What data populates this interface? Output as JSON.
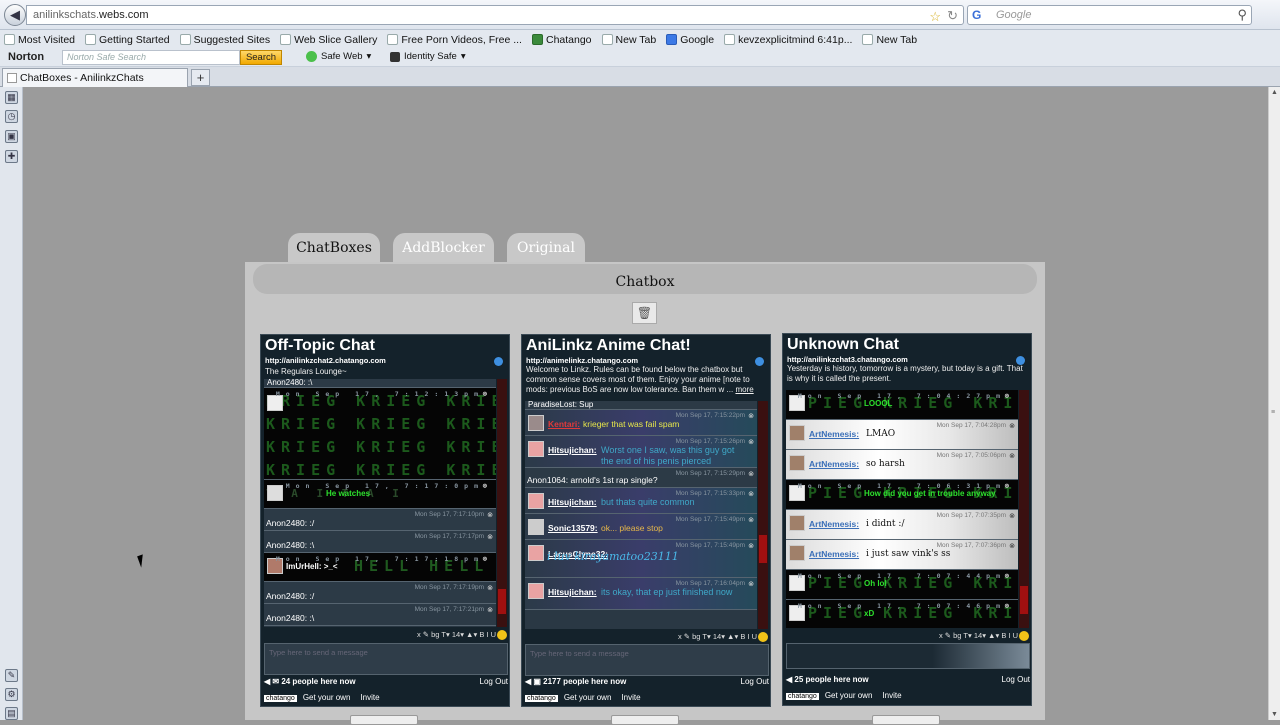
{
  "browser": {
    "url_prefix": "anilinkschats.",
    "url_domain": "webs.com",
    "search_placeholder": "Google",
    "search_engine_icon": "G"
  },
  "bookmarks": [
    "Most Visited",
    "Getting Started",
    "Suggested Sites",
    "Web Slice Gallery",
    "Free Porn Videos, Free ...",
    "Chatango",
    "New Tab",
    "Google",
    "kevzexplicitmind 6:41p...",
    "New Tab"
  ],
  "norton": {
    "logo": "Norton",
    "search_placeholder": "Norton Safe Search",
    "search_button": "Search",
    "safe_web": "Safe Web",
    "identity_safe": "Identity Safe"
  },
  "tab": {
    "title": "ChatBoxes - AnilinkzChats",
    "new_tab": "+"
  },
  "site": {
    "tabs": [
      "ChatBoxes",
      "AddBlocker",
      "Original"
    ],
    "header": "Chatbox"
  },
  "chats": [
    {
      "title": "Off-Topic Chat",
      "url": "http://anilinkzchat2.chatango.com",
      "desc": "The Regulars Lounge~",
      "people": "24 people here now",
      "logout": "Log Out",
      "top_clip": "Anon2480: :\\",
      "messages": [
        {
          "kind": "krieg",
          "big": true,
          "ts": "Mon Sep 17, 7:12:13pm",
          "text": "KRIEG KRIEG KRIE"
        },
        {
          "kind": "krieg2",
          "ts": "Mon Sep 17, 7:15:40pm",
          "text": "KRIEG KRIEG KRIE"
        },
        {
          "kind": "krieg3",
          "name": "",
          "ts": "Mon Sep 17, 7:17:0pm",
          "text": "He watches",
          "bg": "T A I   T A I"
        },
        {
          "kind": "plain",
          "ts": "Mon Sep 17, 7:17:10pm",
          "text": "Anon2480: :/"
        },
        {
          "kind": "plain",
          "ts": "Mon Sep 17, 7:17:17pm",
          "text": "Anon2480: :\\"
        },
        {
          "kind": "hell",
          "name": "ImUrHell:",
          "ts": "Mon Sep 17, 7:17:18pm",
          "text": ">_<",
          "bg": "HELL  HELL  HEL"
        },
        {
          "kind": "plain",
          "ts": "Mon Sep 17, 7:17:19pm",
          "text": "Anon2480: :/"
        },
        {
          "kind": "plain",
          "ts": "Mon Sep 17, 7:17:21pm",
          "text": "Anon2480: :\\"
        }
      ]
    },
    {
      "title": "AniLinkz Anime Chat!",
      "url": "http://animelinkz.chatango.com",
      "desc": "Welcome to Linkz. Rules can be found below the chatbox but common sense covers most of them. Enjoy your anime  [note to mods: previous BoS are now low tolerance. Ban them w ...",
      "more": "more",
      "people": "2177 people here now",
      "logout": "Log Out",
      "top_clip": "ParadiseLost: Sup",
      "messages": [
        {
          "kind": "user",
          "name": "Kentari:",
          "name_color": "#e03a3a",
          "ts": "Mon Sep 17, 7:15:22pm",
          "text": "krieger that was fail spam",
          "color": "#e8e84a"
        },
        {
          "kind": "user2",
          "name": "Hitsujichan:",
          "ts": "Mon Sep 17, 7:15:26pm",
          "text": "Worst one I saw, was this guy got the end of his penis pierced",
          "color": "#3fa8c8"
        },
        {
          "kind": "plain",
          "ts": "Mon Sep 17, 7:15:29pm",
          "text": "Anon1064: arnold's 1st rap single?"
        },
        {
          "kind": "user",
          "name": "Hitsujichan:",
          "ts": "Mon Sep 17, 7:15:33pm",
          "text": "but thats quite common",
          "color": "#3fa8c8"
        },
        {
          "kind": "user",
          "name": "Sonic13579:",
          "ts": "Mon Sep 17, 7:15:49pm",
          "text": "ok... please stop",
          "color": "#e8b84a"
        },
        {
          "kind": "user2",
          "name": "LacusClyne32:",
          "ts": "Mon Sep 17, 7:15:49pm",
          "text": "i luv kirayamatoo23111",
          "color": "#4ab8e8"
        },
        {
          "kind": "user2",
          "name": "Hitsujichan:",
          "ts": "Mon Sep 17, 7:16:04pm",
          "text": "its okay, that ep just finished now",
          "color": "#3fa8c8"
        }
      ]
    },
    {
      "title": "Unknown Chat",
      "url": "http://anilinkzchat3.chatango.com",
      "desc": "Yesterday is history, tomorrow is a mystery, but today is a gift. That is why it is called the present.",
      "people": "25 people here now",
      "logout": "Log Out",
      "top_clip": "",
      "messages": [
        {
          "kind": "krieg",
          "big": true,
          "ts": "Mon Sep 17, 7:04:27pm",
          "text": "LOOOL",
          "color": "#2de02d"
        },
        {
          "kind": "snow",
          "name": "ArtNemesis:",
          "ts": "Mon Sep 17, 7:04:28pm",
          "text": "LMAO"
        },
        {
          "kind": "snow",
          "name": "ArtNemesis:",
          "ts": "Mon Sep 17, 7:05:06pm",
          "text": "so harsh"
        },
        {
          "kind": "krieg",
          "big": true,
          "ts": "Mon Sep 17, 7:06:31pm",
          "text": "How did you get in trouble anyway",
          "color": "#2de02d"
        },
        {
          "kind": "snow",
          "name": "ArtNemesis:",
          "ts": "Mon Sep 17, 7:07:35pm",
          "text": "i didnt :/"
        },
        {
          "kind": "snow",
          "name": "ArtNemesis:",
          "ts": "Mon Sep 17, 7:07:36pm",
          "text": "i just saw vink's ss"
        },
        {
          "kind": "krieg",
          "big": true,
          "ts": "Mon Sep 17, 7:07:44pm",
          "text": "Oh lol",
          "color": "#2de02d"
        },
        {
          "kind": "krieg",
          "big": true,
          "ts": "Mon Sep 17, 7:07:46pm",
          "text": "xD",
          "color": "#2de02d"
        }
      ]
    }
  ],
  "chat_common": {
    "placeholder": "Type here to send a message",
    "chatango_badge": "chatango",
    "get_own": "Get your own",
    "invite": "Invite",
    "fmt": "x  ✎  bg  T▾  14▾  ▲▾  B  I  U"
  }
}
